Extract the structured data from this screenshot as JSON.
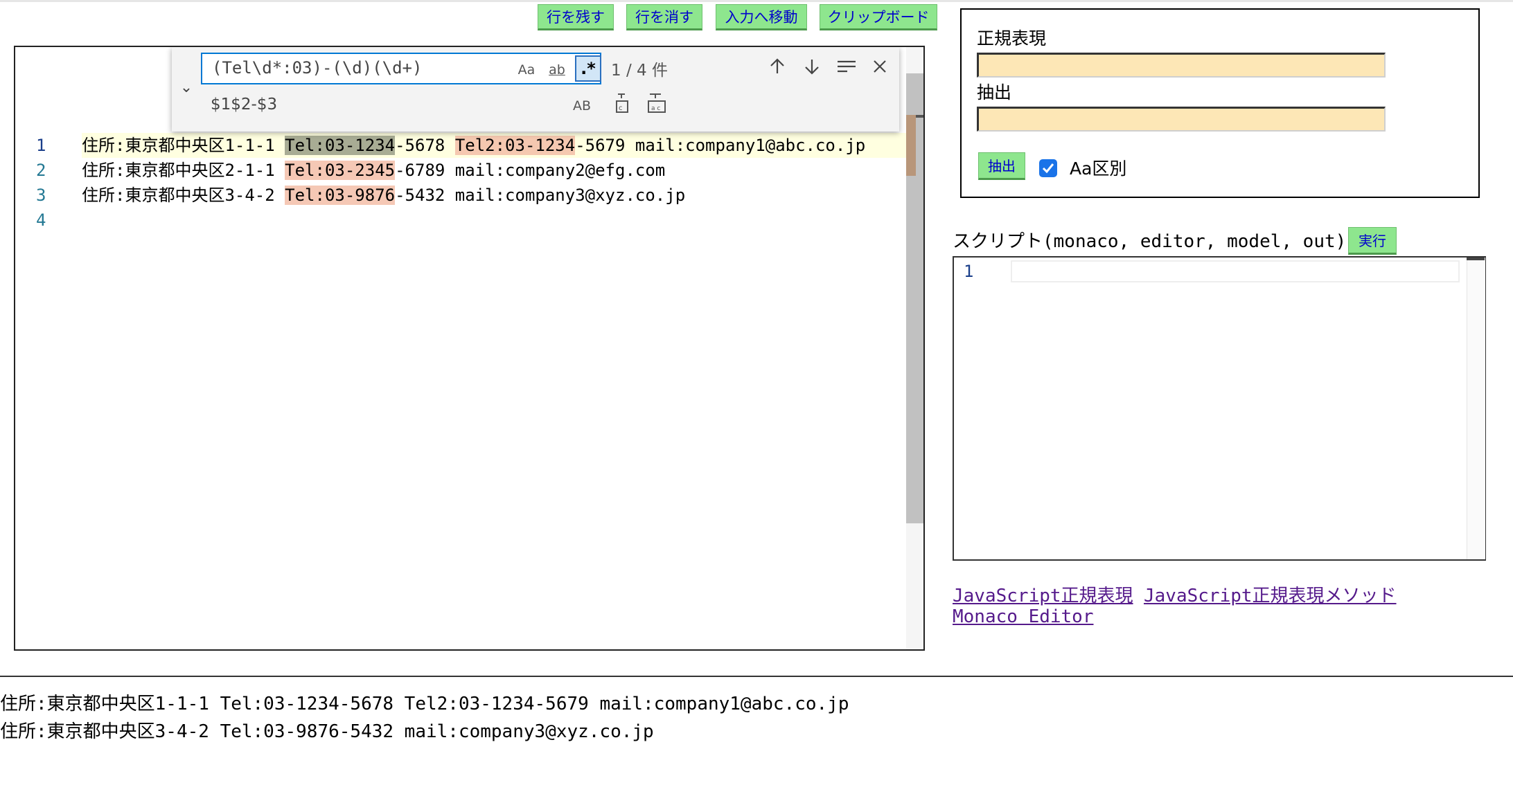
{
  "toolbar": {
    "keep_lines": "行を残す",
    "delete_lines": "行を消す",
    "goto_input": "入力へ移動",
    "clipboard": "クリップボード"
  },
  "find_widget": {
    "search_value": "(Tel\\d*:03)-(\\d)(\\d+)",
    "replace_value": "$1$2-$3",
    "match_case_label": "Aa",
    "whole_word_label": "ab",
    "regex_label": ".*",
    "preserve_case_label": "AB",
    "match_count": "1 / 4 件"
  },
  "editor": {
    "line_numbers": [
      "1",
      "2",
      "3",
      "4"
    ],
    "lines": [
      {
        "pre": "住所:東京都中央区1-1-1 ",
        "m1": "Tel:03-1234",
        "mid1": "-5678 ",
        "m2": "Tel2:03-1234",
        "post": "-5679 mail:company1@abc.co.jp"
      },
      {
        "pre": "住所:東京都中央区2-1-1 ",
        "m1": "Tel:03-2345",
        "post": "-6789 mail:company2@efg.com"
      },
      {
        "pre": "住所:東京都中央区3-4-2 ",
        "m1": "Tel:03-9876",
        "post": "-5432 mail:company3@xyz.co.jp"
      }
    ]
  },
  "panel": {
    "regex_label": "正規表現",
    "regex_value": "",
    "extract_label": "抽出",
    "extract_value": "",
    "extract_button": "抽出",
    "case_sensitive_label": "Aa区別",
    "case_sensitive_checked": true
  },
  "script": {
    "label": "スクリプト(monaco, editor, model, out)",
    "run_button": "実行",
    "line_number": "1"
  },
  "links": {
    "regex": "JavaScript正規表現",
    "regex_methods": "JavaScript正規表現メソッド",
    "monaco": "Monaco Editor"
  },
  "output": {
    "lines": [
      "住所:東京都中央区1-1-1 Tel:03-1234-5678 Tel2:03-1234-5679 mail:company1@abc.co.jp",
      "住所:東京都中央区3-4-2 Tel:03-9876-5432 mail:company3@xyz.co.jp"
    ]
  },
  "colors": {
    "button_bg": "#8ee68e",
    "button_text": "#0000cc",
    "input_bg": "#fde7b6",
    "current_match": "#a8ac94",
    "other_match": "#f5c8b5",
    "checkbox": "#1a73e8"
  }
}
